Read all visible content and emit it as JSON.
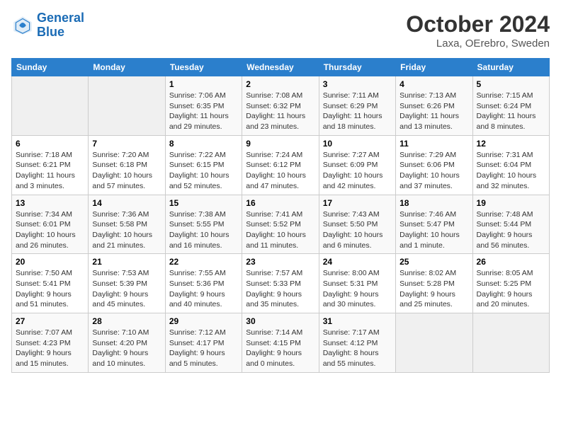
{
  "header": {
    "logo_line1": "General",
    "logo_line2": "Blue",
    "month": "October 2024",
    "location": "Laxa, OErebro, Sweden"
  },
  "weekdays": [
    "Sunday",
    "Monday",
    "Tuesday",
    "Wednesday",
    "Thursday",
    "Friday",
    "Saturday"
  ],
  "weeks": [
    [
      {
        "day": "",
        "sunrise": "",
        "sunset": "",
        "daylight": ""
      },
      {
        "day": "",
        "sunrise": "",
        "sunset": "",
        "daylight": ""
      },
      {
        "day": "1",
        "sunrise": "Sunrise: 7:06 AM",
        "sunset": "Sunset: 6:35 PM",
        "daylight": "Daylight: 11 hours and 29 minutes."
      },
      {
        "day": "2",
        "sunrise": "Sunrise: 7:08 AM",
        "sunset": "Sunset: 6:32 PM",
        "daylight": "Daylight: 11 hours and 23 minutes."
      },
      {
        "day": "3",
        "sunrise": "Sunrise: 7:11 AM",
        "sunset": "Sunset: 6:29 PM",
        "daylight": "Daylight: 11 hours and 18 minutes."
      },
      {
        "day": "4",
        "sunrise": "Sunrise: 7:13 AM",
        "sunset": "Sunset: 6:26 PM",
        "daylight": "Daylight: 11 hours and 13 minutes."
      },
      {
        "day": "5",
        "sunrise": "Sunrise: 7:15 AM",
        "sunset": "Sunset: 6:24 PM",
        "daylight": "Daylight: 11 hours and 8 minutes."
      }
    ],
    [
      {
        "day": "6",
        "sunrise": "Sunrise: 7:18 AM",
        "sunset": "Sunset: 6:21 PM",
        "daylight": "Daylight: 11 hours and 3 minutes."
      },
      {
        "day": "7",
        "sunrise": "Sunrise: 7:20 AM",
        "sunset": "Sunset: 6:18 PM",
        "daylight": "Daylight: 10 hours and 57 minutes."
      },
      {
        "day": "8",
        "sunrise": "Sunrise: 7:22 AM",
        "sunset": "Sunset: 6:15 PM",
        "daylight": "Daylight: 10 hours and 52 minutes."
      },
      {
        "day": "9",
        "sunrise": "Sunrise: 7:24 AM",
        "sunset": "Sunset: 6:12 PM",
        "daylight": "Daylight: 10 hours and 47 minutes."
      },
      {
        "day": "10",
        "sunrise": "Sunrise: 7:27 AM",
        "sunset": "Sunset: 6:09 PM",
        "daylight": "Daylight: 10 hours and 42 minutes."
      },
      {
        "day": "11",
        "sunrise": "Sunrise: 7:29 AM",
        "sunset": "Sunset: 6:06 PM",
        "daylight": "Daylight: 10 hours and 37 minutes."
      },
      {
        "day": "12",
        "sunrise": "Sunrise: 7:31 AM",
        "sunset": "Sunset: 6:04 PM",
        "daylight": "Daylight: 10 hours and 32 minutes."
      }
    ],
    [
      {
        "day": "13",
        "sunrise": "Sunrise: 7:34 AM",
        "sunset": "Sunset: 6:01 PM",
        "daylight": "Daylight: 10 hours and 26 minutes."
      },
      {
        "day": "14",
        "sunrise": "Sunrise: 7:36 AM",
        "sunset": "Sunset: 5:58 PM",
        "daylight": "Daylight: 10 hours and 21 minutes."
      },
      {
        "day": "15",
        "sunrise": "Sunrise: 7:38 AM",
        "sunset": "Sunset: 5:55 PM",
        "daylight": "Daylight: 10 hours and 16 minutes."
      },
      {
        "day": "16",
        "sunrise": "Sunrise: 7:41 AM",
        "sunset": "Sunset: 5:52 PM",
        "daylight": "Daylight: 10 hours and 11 minutes."
      },
      {
        "day": "17",
        "sunrise": "Sunrise: 7:43 AM",
        "sunset": "Sunset: 5:50 PM",
        "daylight": "Daylight: 10 hours and 6 minutes."
      },
      {
        "day": "18",
        "sunrise": "Sunrise: 7:46 AM",
        "sunset": "Sunset: 5:47 PM",
        "daylight": "Daylight: 10 hours and 1 minute."
      },
      {
        "day": "19",
        "sunrise": "Sunrise: 7:48 AM",
        "sunset": "Sunset: 5:44 PM",
        "daylight": "Daylight: 9 hours and 56 minutes."
      }
    ],
    [
      {
        "day": "20",
        "sunrise": "Sunrise: 7:50 AM",
        "sunset": "Sunset: 5:41 PM",
        "daylight": "Daylight: 9 hours and 51 minutes."
      },
      {
        "day": "21",
        "sunrise": "Sunrise: 7:53 AM",
        "sunset": "Sunset: 5:39 PM",
        "daylight": "Daylight: 9 hours and 45 minutes."
      },
      {
        "day": "22",
        "sunrise": "Sunrise: 7:55 AM",
        "sunset": "Sunset: 5:36 PM",
        "daylight": "Daylight: 9 hours and 40 minutes."
      },
      {
        "day": "23",
        "sunrise": "Sunrise: 7:57 AM",
        "sunset": "Sunset: 5:33 PM",
        "daylight": "Daylight: 9 hours and 35 minutes."
      },
      {
        "day": "24",
        "sunrise": "Sunrise: 8:00 AM",
        "sunset": "Sunset: 5:31 PM",
        "daylight": "Daylight: 9 hours and 30 minutes."
      },
      {
        "day": "25",
        "sunrise": "Sunrise: 8:02 AM",
        "sunset": "Sunset: 5:28 PM",
        "daylight": "Daylight: 9 hours and 25 minutes."
      },
      {
        "day": "26",
        "sunrise": "Sunrise: 8:05 AM",
        "sunset": "Sunset: 5:25 PM",
        "daylight": "Daylight: 9 hours and 20 minutes."
      }
    ],
    [
      {
        "day": "27",
        "sunrise": "Sunrise: 7:07 AM",
        "sunset": "Sunset: 4:23 PM",
        "daylight": "Daylight: 9 hours and 15 minutes."
      },
      {
        "day": "28",
        "sunrise": "Sunrise: 7:10 AM",
        "sunset": "Sunset: 4:20 PM",
        "daylight": "Daylight: 9 hours and 10 minutes."
      },
      {
        "day": "29",
        "sunrise": "Sunrise: 7:12 AM",
        "sunset": "Sunset: 4:17 PM",
        "daylight": "Daylight: 9 hours and 5 minutes."
      },
      {
        "day": "30",
        "sunrise": "Sunrise: 7:14 AM",
        "sunset": "Sunset: 4:15 PM",
        "daylight": "Daylight: 9 hours and 0 minutes."
      },
      {
        "day": "31",
        "sunrise": "Sunrise: 7:17 AM",
        "sunset": "Sunset: 4:12 PM",
        "daylight": "Daylight: 8 hours and 55 minutes."
      },
      {
        "day": "",
        "sunrise": "",
        "sunset": "",
        "daylight": ""
      },
      {
        "day": "",
        "sunrise": "",
        "sunset": "",
        "daylight": ""
      }
    ]
  ]
}
